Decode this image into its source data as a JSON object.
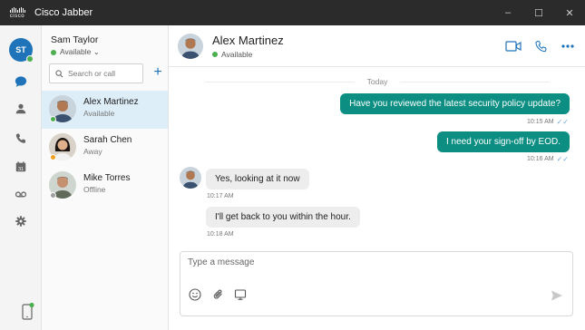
{
  "window": {
    "brand": "cisco",
    "title": "Cisco Jabber",
    "controls": {
      "minimize": "–",
      "maximize": "☐",
      "close": "✕"
    }
  },
  "self": {
    "initials": "ST",
    "name": "Sam Taylor",
    "status": "Available ⌄"
  },
  "rail": {
    "items": [
      "chat-icon",
      "contacts-icon",
      "phone-icon",
      "calendar-icon",
      "voicemail-icon",
      "settings-icon"
    ],
    "calendar_day": "31",
    "active": "chat-icon"
  },
  "search": {
    "placeholder": "Search or call",
    "add_label": "+"
  },
  "contacts": [
    {
      "name": "Alex Martinez",
      "status": "Available",
      "presence_color": "#4caf50",
      "active": true
    },
    {
      "name": "Sarah Chen",
      "status": "Away",
      "presence_color": "#f0a020",
      "active": false
    },
    {
      "name": "Mike Torres",
      "status": "Offline",
      "presence_color": "#9e9e9e",
      "active": false
    }
  ],
  "conversation": {
    "contact_name": "Alex Martinez",
    "contact_status": "Available",
    "actions": [
      "video-call-icon",
      "phone-call-icon",
      "more-icon"
    ],
    "date_divider": "Today",
    "messages": [
      {
        "direction": "out",
        "text": "Have you reviewed the latest security policy update?",
        "time": "10:15 AM",
        "read": "✓✓"
      },
      {
        "direction": "out",
        "text": "I need your sign-off by EOD.",
        "time": "10:16 AM",
        "read": "✓✓"
      },
      {
        "direction": "in",
        "text": "Yes, looking at it now",
        "time": "10:17 AM"
      },
      {
        "direction": "in",
        "text": "I'll get back to you within the hour.",
        "time": "10:18 AM"
      }
    ]
  },
  "composer": {
    "placeholder": "Type a message",
    "tools": [
      "emoji-icon",
      "attachment-icon",
      "screen-share-icon"
    ],
    "send": "send-icon"
  },
  "colors": {
    "accent": "#1e73b9",
    "outgoing_bubble": "#0c8f82",
    "incoming_bubble": "#ededed",
    "available": "#4caf50",
    "away": "#f0a020",
    "offline": "#9e9e9e"
  }
}
